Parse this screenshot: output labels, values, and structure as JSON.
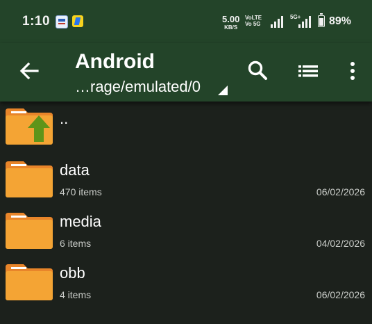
{
  "status_bar": {
    "time": "1:10",
    "net_speed_value": "5.00",
    "net_speed_unit": "KB/S",
    "volte_line1": "VoLTE",
    "volte_line2": "Vo 5G",
    "signal_5g_label": "5G+",
    "battery_percent": "89%",
    "notification_icons": [
      "idea-app-icon",
      "flipkart-app-icon"
    ]
  },
  "toolbar": {
    "folder_title": "Android",
    "path": "…rage/emulated/0",
    "background_color": "#234429",
    "actions": [
      "search-icon",
      "view-list-icon",
      "more-vertical-icon"
    ]
  },
  "files": {
    "parent": {
      "name": ".."
    },
    "items": [
      {
        "name": "data",
        "count": "470 items",
        "date": "06/02/2026"
      },
      {
        "name": "media",
        "count": "6 items",
        "date": "04/02/2026"
      },
      {
        "name": "obb",
        "count": "4 items",
        "date": "06/02/2026"
      }
    ],
    "folder_color": "#f4a434",
    "folder_tab_color": "#e8852a",
    "up_arrow_color": "#5f9419"
  }
}
